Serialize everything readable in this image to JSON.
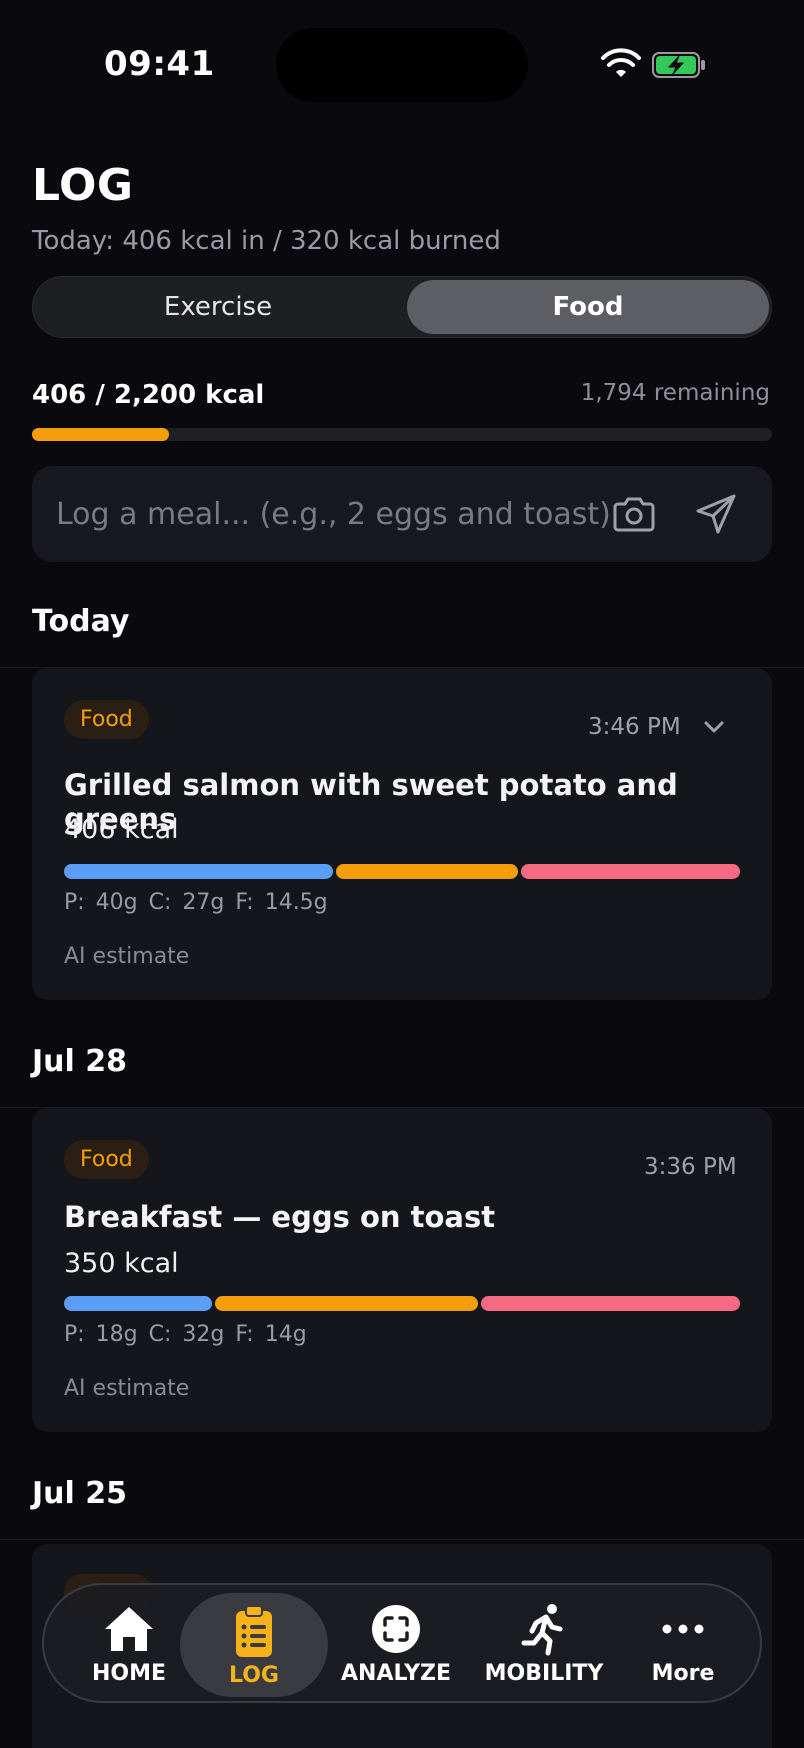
{
  "status_bar": {
    "time": "09:41"
  },
  "header": {
    "title": "LOG",
    "subtitle": "Today: 406 kcal in / 320 kcal burned"
  },
  "segmented": {
    "exercise_label": "Exercise",
    "food_label": "Food",
    "selected": "Food"
  },
  "calories": {
    "summary": "406 / 2,200 kcal",
    "remaining": "1,794 remaining",
    "consumed": 406,
    "goal": 2200,
    "progress_fraction": 0.185
  },
  "meal_input": {
    "placeholder": "Log a meal... (e.g., 2 eggs and toast)",
    "value": ""
  },
  "sections": [
    {
      "header": "Today",
      "entries": [
        {
          "badge": "Food",
          "time": "3:46 PM",
          "title": "Grilled salmon with sweet potato and greens",
          "kcal": "406 kcal",
          "macros_text": "P: 40g  C: 27g  F: 14.5g",
          "macros": {
            "protein_g": 40,
            "carbs_g": 27,
            "fat_g": 14.5
          },
          "note": "AI estimate"
        }
      ]
    },
    {
      "header": "Jul 28",
      "entries": [
        {
          "badge": "Food",
          "time": "3:36 PM",
          "title": "Breakfast — eggs on toast",
          "kcal": "350 kcal",
          "macros_text": "P: 18g  C: 32g  F: 14g",
          "macros": {
            "protein_g": 18,
            "carbs_g": 32,
            "fat_g": 14
          },
          "note": "AI estimate"
        }
      ]
    },
    {
      "header": "Jul 25",
      "entries": []
    }
  ],
  "tab_bar": {
    "tabs": [
      {
        "label": "HOME",
        "icon": "home-icon"
      },
      {
        "label": "LOG",
        "icon": "clipboard-list-icon",
        "active": true
      },
      {
        "label": "ANALYZE",
        "icon": "scan-icon"
      },
      {
        "label": "MOBILITY",
        "icon": "running-person-icon"
      },
      {
        "label": "More",
        "icon": "ellipsis-icon"
      }
    ]
  },
  "colors": {
    "accent": "#f59e0b",
    "protein": "#5b9ef5",
    "carbs": "#f59e0b",
    "fat": "#f56a82",
    "background": "#0a0a0e",
    "card": "#15161b"
  }
}
